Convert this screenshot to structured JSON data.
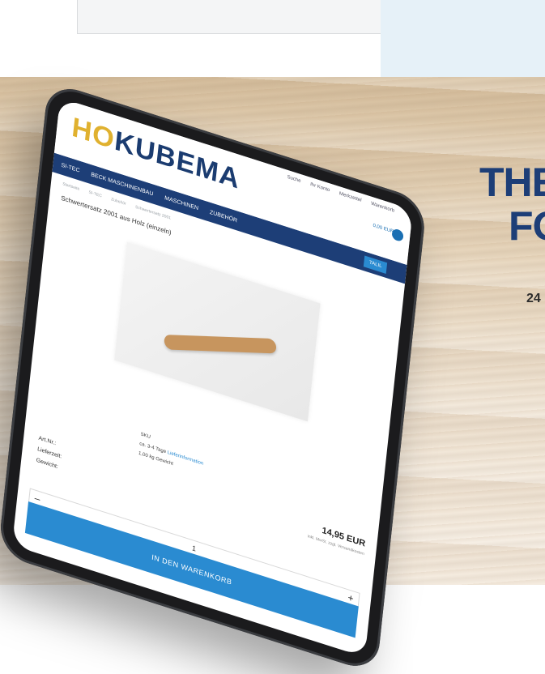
{
  "headline": {
    "line1": "THE",
    "line2": "FO",
    "sub": "24"
  },
  "site": {
    "logo_ho": "HO",
    "logo_main": "KUBEMA",
    "toplinks": [
      "Suche",
      "Ihr Konto",
      "Merkzettel",
      "Warenkorb"
    ],
    "header_right": "0,00 EUR",
    "nav": [
      "SI-TEC",
      "BECK MASCHINENBAU",
      "MASCHINEN",
      "ZUBEHÖR"
    ],
    "nav_cta": "TALIL",
    "breadcrumbs": [
      "Startseite",
      "SI-TEC",
      "Zubehör",
      "Schwertersatz 2001"
    ],
    "product_title": "Schwertersatz 2001 aus Holz (einzeln)"
  },
  "product": {
    "labels": {
      "art": "Art.Nr.:",
      "delivery": "Lieferzeit:",
      "weight": "Gewicht:"
    },
    "values": {
      "art": "SKU",
      "delivery_prefix": "ca. 3-4 Tage",
      "delivery_link": "Lieferinformation",
      "weight": "1,00 kg Gewicht"
    },
    "price": "14,95 EUR",
    "price_note": "inkl. MwSt. zzgl. Versandkosten",
    "qty_minus": "–",
    "qty_value": "1",
    "qty_plus": "+",
    "add_to_cart": "IN DEN WARENKORB"
  },
  "colors": {
    "navy": "#1d3e77",
    "accent": "#2a8bd1",
    "logo_gold": "#e0b12f"
  }
}
